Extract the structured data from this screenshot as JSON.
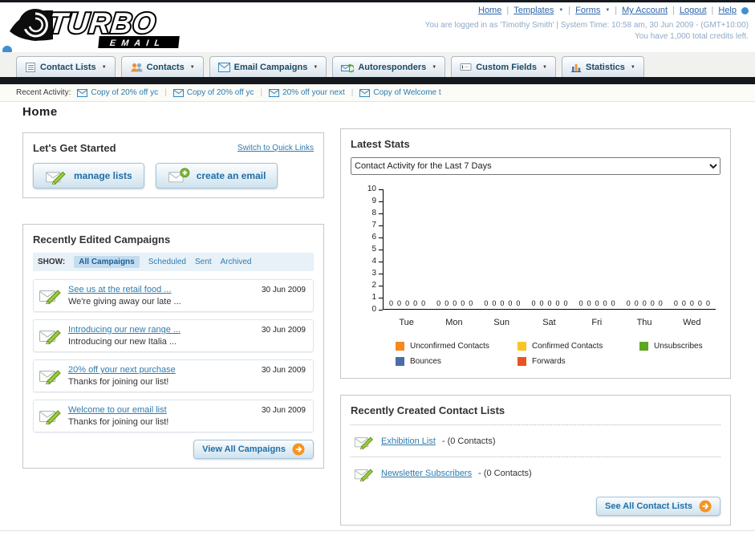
{
  "header": {
    "logo": {
      "title": "TURBO",
      "subtitle": "EMAIL"
    },
    "links": [
      {
        "label": "Home",
        "has_dropdown": false
      },
      {
        "label": "Templates",
        "has_dropdown": true
      },
      {
        "label": "Forms",
        "has_dropdown": true
      },
      {
        "label": "My Account",
        "has_dropdown": false
      },
      {
        "label": "Logout",
        "has_dropdown": false
      },
      {
        "label": "Help",
        "has_dropdown": false
      }
    ],
    "login_info": "You are logged in as 'Timothy Smith' | System Time: 10:58 am, 30 Jun 2009 - (GMT+10:00)",
    "credits_info": "You have 1,000 total credits left."
  },
  "nav": {
    "tabs": [
      {
        "label": "Contact Lists"
      },
      {
        "label": "Contacts"
      },
      {
        "label": "Email Campaigns"
      },
      {
        "label": "Autoresponders"
      },
      {
        "label": "Custom Fields"
      },
      {
        "label": "Statistics"
      }
    ]
  },
  "activity": {
    "label": "Recent Activity:",
    "items": [
      "Copy of 20% off yc",
      "Copy of 20% off yc",
      "20% off your next",
      "Copy of Welcome t"
    ]
  },
  "page": {
    "title": "Home"
  },
  "get_started": {
    "title": "Let's Get Started",
    "switch_link": "Switch to Quick Links",
    "manage_button": "manage lists",
    "create_button": "create an email"
  },
  "campaigns": {
    "title": "Recently Edited Campaigns",
    "show_label": "SHOW:",
    "tabs": [
      "All Campaigns",
      "Scheduled",
      "Sent",
      "Archived"
    ],
    "selected_tab": "All Campaigns",
    "items": [
      {
        "title": "See us at the retail food ...",
        "subtitle": "We're giving away our late ...",
        "date": "30 Jun 2009"
      },
      {
        "title": "Introducing our new range ...",
        "subtitle": "Introducing our new Italia ...",
        "date": "30 Jun 2009"
      },
      {
        "title": "20% off your next purchase",
        "subtitle": "Thanks for joining our list!",
        "date": "30 Jun 2009"
      },
      {
        "title": "Welcome to our email list",
        "subtitle": "Thanks for joining our list!",
        "date": "30 Jun 2009"
      }
    ],
    "view_all_label": "View All Campaigns"
  },
  "stats": {
    "title": "Latest Stats"
  },
  "chart_data": {
    "type": "bar",
    "title": "Contact Activity for the Last 7 Days",
    "categories": [
      "Tue",
      "Mon",
      "Sun",
      "Sat",
      "Fri",
      "Thu",
      "Wed"
    ],
    "series": [
      {
        "name": "Unconfirmed Contacts",
        "color": "#f6891f",
        "values": [
          0,
          0,
          0,
          0,
          0,
          0,
          0
        ]
      },
      {
        "name": "Confirmed Contacts",
        "color": "#f9c428",
        "values": [
          0,
          0,
          0,
          0,
          0,
          0,
          0
        ]
      },
      {
        "name": "Unsubscribes",
        "color": "#61a623",
        "values": [
          0,
          0,
          0,
          0,
          0,
          0,
          0
        ]
      },
      {
        "name": "Bounces",
        "color": "#4a6da7",
        "values": [
          0,
          0,
          0,
          0,
          0,
          0,
          0
        ]
      },
      {
        "name": "Forwards",
        "color": "#e85420",
        "values": [
          0,
          0,
          0,
          0,
          0,
          0,
          0
        ]
      }
    ],
    "xlabel": "",
    "ylabel": "",
    "ylim": [
      0,
      10
    ],
    "ytick_step": 1,
    "grid": false,
    "legend_position": "bottom",
    "value_labels_shown": true
  },
  "contact_lists": {
    "title": "Recently Created Contact Lists",
    "items": [
      {
        "name": "Exhibition List",
        "detail": "- (0 Contacts)"
      },
      {
        "name": "Newsletter Subscribers",
        "detail": "- (0 Contacts)"
      }
    ],
    "see_all_label": "See All Contact Lists"
  }
}
